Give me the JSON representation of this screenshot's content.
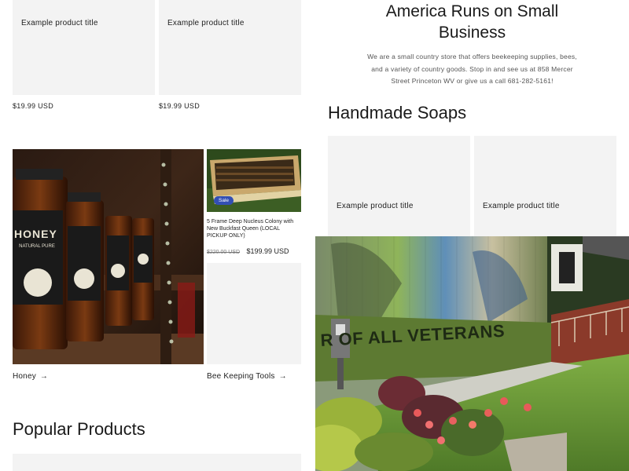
{
  "top_products": [
    {
      "title": "Example product title",
      "price": "$19.99 USD"
    },
    {
      "title": "Example product title",
      "price": "$19.99 USD"
    }
  ],
  "hero": {
    "title_line1": "America Runs on Small",
    "title_line2": "Business",
    "text_line1": "We are a small country store that offers beekeeping supplies, bees,",
    "text_line2": "and a variety of country goods. Stop in and see us at 858 Mercer",
    "text_line3": "Street Princeton WV or give us a call 681-282-5161!"
  },
  "soaps": {
    "heading": "Handmade Soaps",
    "products": [
      {
        "title": "Example product title"
      },
      {
        "title": "Example product title"
      }
    ]
  },
  "collections": {
    "honey_label": "Honey",
    "honey_jar_text": "HONEY",
    "honey_jar_sub": "NATURAL PURE",
    "tools_label": "Bee Keeping Tools",
    "arrow": "→"
  },
  "featured": {
    "badge": "Sale",
    "title": "5 Frame Deep Nucleus Colony with New Buckfast Queen (LOCAL PICKUP ONLY)",
    "compare_price": "$220.00 USD",
    "sale_price": "$199.99 USD"
  },
  "mural": {
    "wall_text": "R OF ALL VETERANS"
  },
  "popular": {
    "heading": "Popular Products"
  },
  "colors": {
    "badge": "#334fb4",
    "card_bg": "#f3f3f3",
    "mural_green": "#5d7a32",
    "grass": "#6e9c3a"
  }
}
